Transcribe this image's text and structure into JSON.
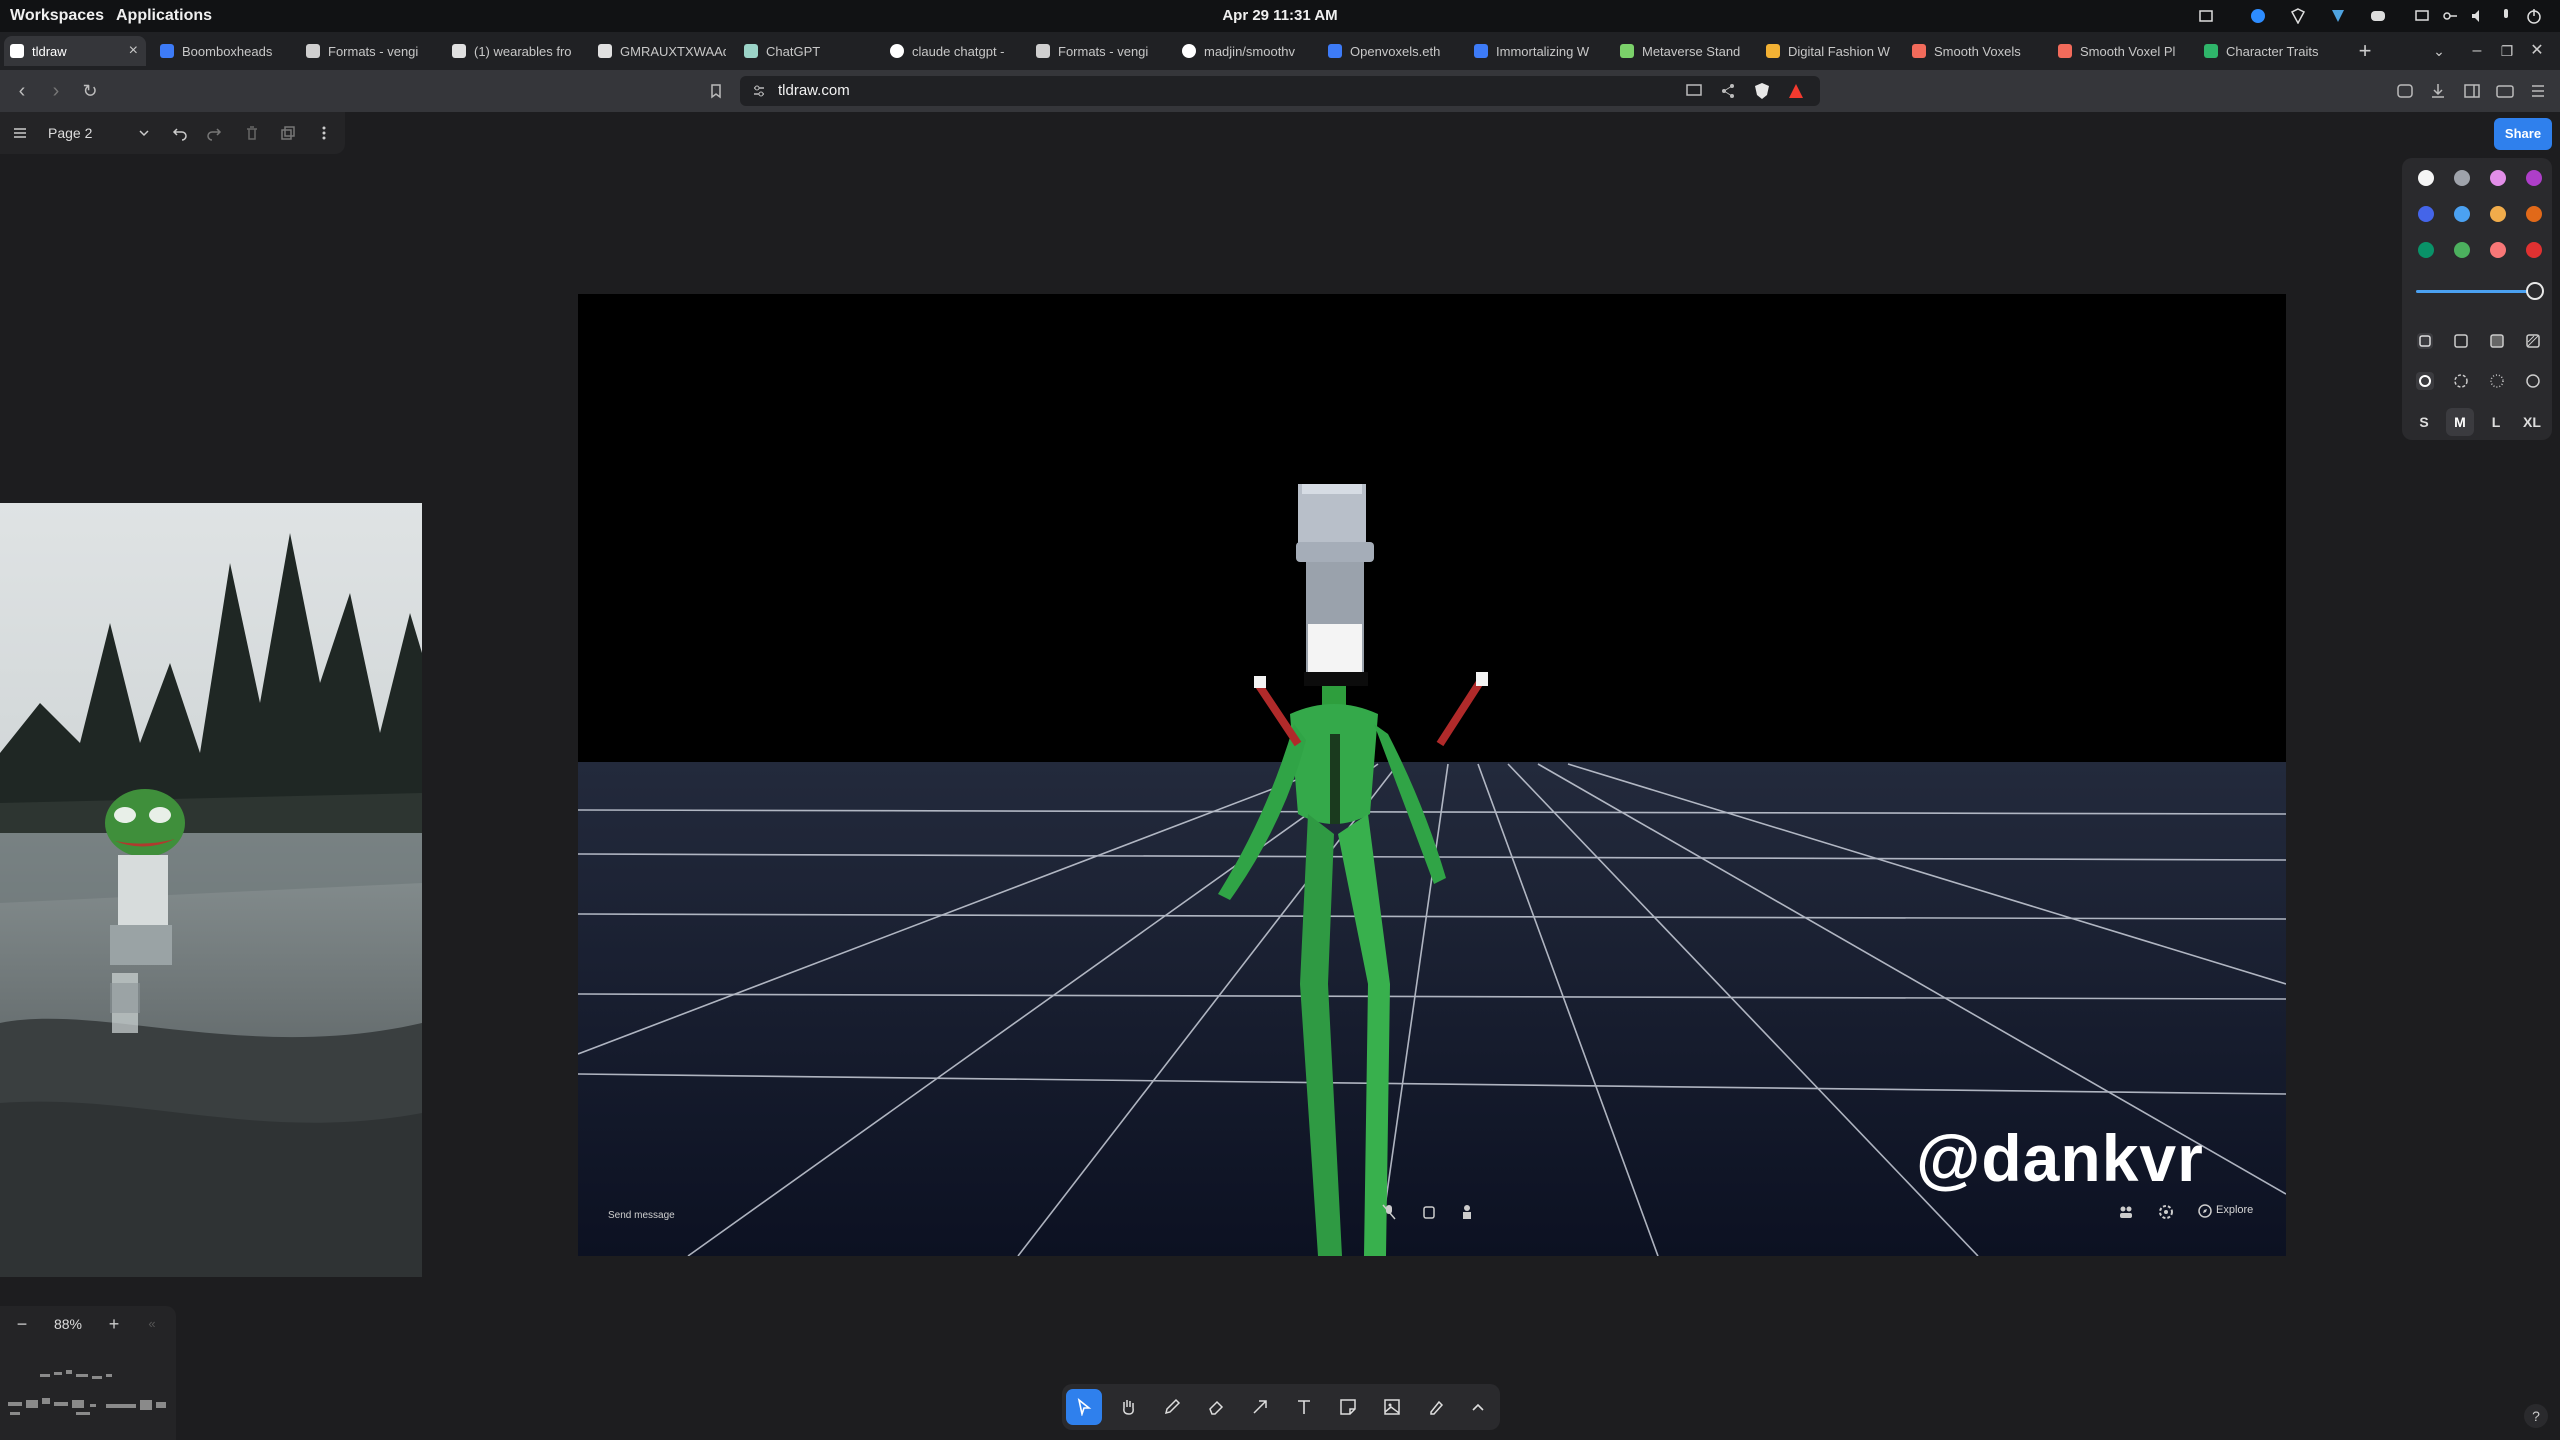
{
  "os": {
    "menu_workspaces": "Workspaces",
    "menu_applications": "Applications",
    "clock": "Apr 29  11:31 AM"
  },
  "tabs": [
    {
      "label": "tldraw",
      "active": true,
      "favicon_color": "#ffffff"
    },
    {
      "label": "Boomboxheads",
      "favicon_color": "#3d7bf7"
    },
    {
      "label": "Formats - vengi",
      "favicon_color": "#cfcfcf"
    },
    {
      "label": "(1) wearables fro",
      "favicon_color": "#e0e0e0"
    },
    {
      "label": "GMRAUXTXWAAd",
      "favicon_color": "#e0e0e0"
    },
    {
      "label": "ChatGPT",
      "favicon_color": "#9bd3c7"
    },
    {
      "label": "claude chatgpt -",
      "favicon_color": "#ffffff"
    },
    {
      "label": "Formats - vengi",
      "favicon_color": "#cfcfcf"
    },
    {
      "label": "madjin/smoothv",
      "favicon_color": "#ffffff"
    },
    {
      "label": "Openvoxels.eth",
      "favicon_color": "#3d7bf7"
    },
    {
      "label": "Immortalizing W",
      "favicon_color": "#3d7bf7"
    },
    {
      "label": "Metaverse Stand",
      "favicon_color": "#7bd16a"
    },
    {
      "label": "Digital Fashion W",
      "favicon_color": "#f2b134"
    },
    {
      "label": "Smooth Voxels",
      "favicon_color": "#f26b5b"
    },
    {
      "label": "Smooth Voxel Pl",
      "favicon_color": "#f26b5b"
    },
    {
      "label": "Character Traits",
      "favicon_color": "#2fb56a"
    }
  ],
  "browser": {
    "url": "tldraw.com",
    "new_tab": "+"
  },
  "tldraw": {
    "page_name": "Page 2",
    "share_label": "Share",
    "zoom": "88%",
    "sizes": [
      "S",
      "M",
      "L",
      "XL"
    ],
    "selected_size": "M",
    "help": "?",
    "colors": [
      "#f5f5f5",
      "#9fa3ab",
      "#e28ee8",
      "#ae3ec9",
      "#4465e9",
      "#4ba1f1",
      "#f1ac4b",
      "#e16919",
      "#099268",
      "#4cb05e",
      "#f87777",
      "#e03131"
    ],
    "opacity": 1.0,
    "tools": [
      "select-tool",
      "hand-tool",
      "draw-tool",
      "eraser-tool",
      "arrow-tool",
      "text-tool",
      "note-tool",
      "media-tool",
      "highlight-tool",
      "more-tools"
    ]
  },
  "scene": {
    "watermark": "@dankvr",
    "send_message": "Send message",
    "explore": "Explore"
  }
}
